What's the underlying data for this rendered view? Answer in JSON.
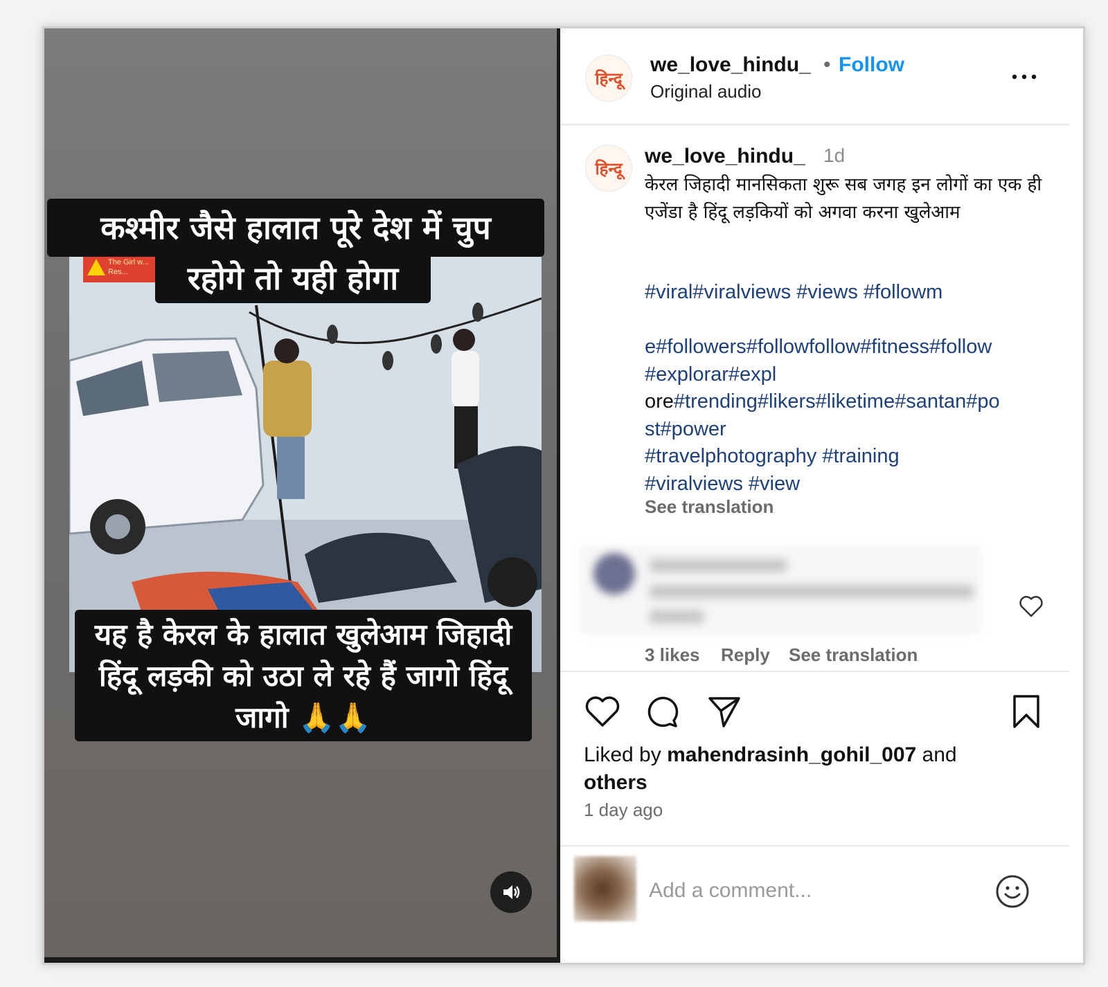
{
  "video": {
    "caption_top_line1": "कश्मीर  जैसे हालात पूरे देश में चुप",
    "caption_top_line2": "रहोगे तो यही होगा",
    "caption_bottom": "यह है केरल के हालात खुलेआम जिहादी हिंदू लड़की को उठा ले रहे हैं जागो हिंदू जागो 🙏🙏",
    "watermark_text": "The Girl w... Res...",
    "sound_icon": "speaker-icon"
  },
  "header": {
    "avatar_text": "हिन्दू",
    "username": "we_love_hindu_",
    "separator": "•",
    "follow_label": "Follow",
    "subtitle": "Original audio",
    "more_icon": "more-horizontal-icon"
  },
  "caption": {
    "avatar_text": "हिन्दू",
    "username": "we_love_hindu_",
    "time": "1d",
    "text": "केरल जिहादी मानसिकता शुरू सब जगह इन लोगों का एक ही एजेंडा है हिंदू लड़कियों को अगवा करना खुलेआम",
    "hashtags_line1": "#viral#viralviews #views #followm",
    "hashtags_line2": "e#followers#followfollow#fitness#follow",
    "hashtags_line3": "#explorar#expl",
    "hashtags_line4_plain": "ore",
    "hashtags_line4_tags": "#trending#likers#liketime#santan#po",
    "hashtags_line5": "st#power",
    "hashtags_line6": "#travelphotography #training",
    "hashtags_line7": "#viralviews #view",
    "see_translation": "See translation"
  },
  "comment": {
    "likes": "3 likes",
    "reply": "Reply",
    "see_translation": "See translation",
    "heart_icon": "heart-outline-icon"
  },
  "actions": {
    "like_icon": "heart-outline-icon",
    "comment_icon": "comment-bubble-icon",
    "share_icon": "paper-plane-icon",
    "save_icon": "bookmark-icon",
    "liked_prefix": "Liked by ",
    "liked_user": "mahendrasinh_gohil_007",
    "liked_and": " and",
    "liked_others": "others",
    "time_ago": "1 day ago"
  },
  "add_comment": {
    "placeholder": "Add a comment...",
    "emoji_icon": "smiley-icon"
  },
  "colors": {
    "follow_blue": "#1494f2",
    "hashtag_navy": "#1d3f7a",
    "muted_gray": "#6c6c6c",
    "brand_orange": "#e0502a"
  }
}
